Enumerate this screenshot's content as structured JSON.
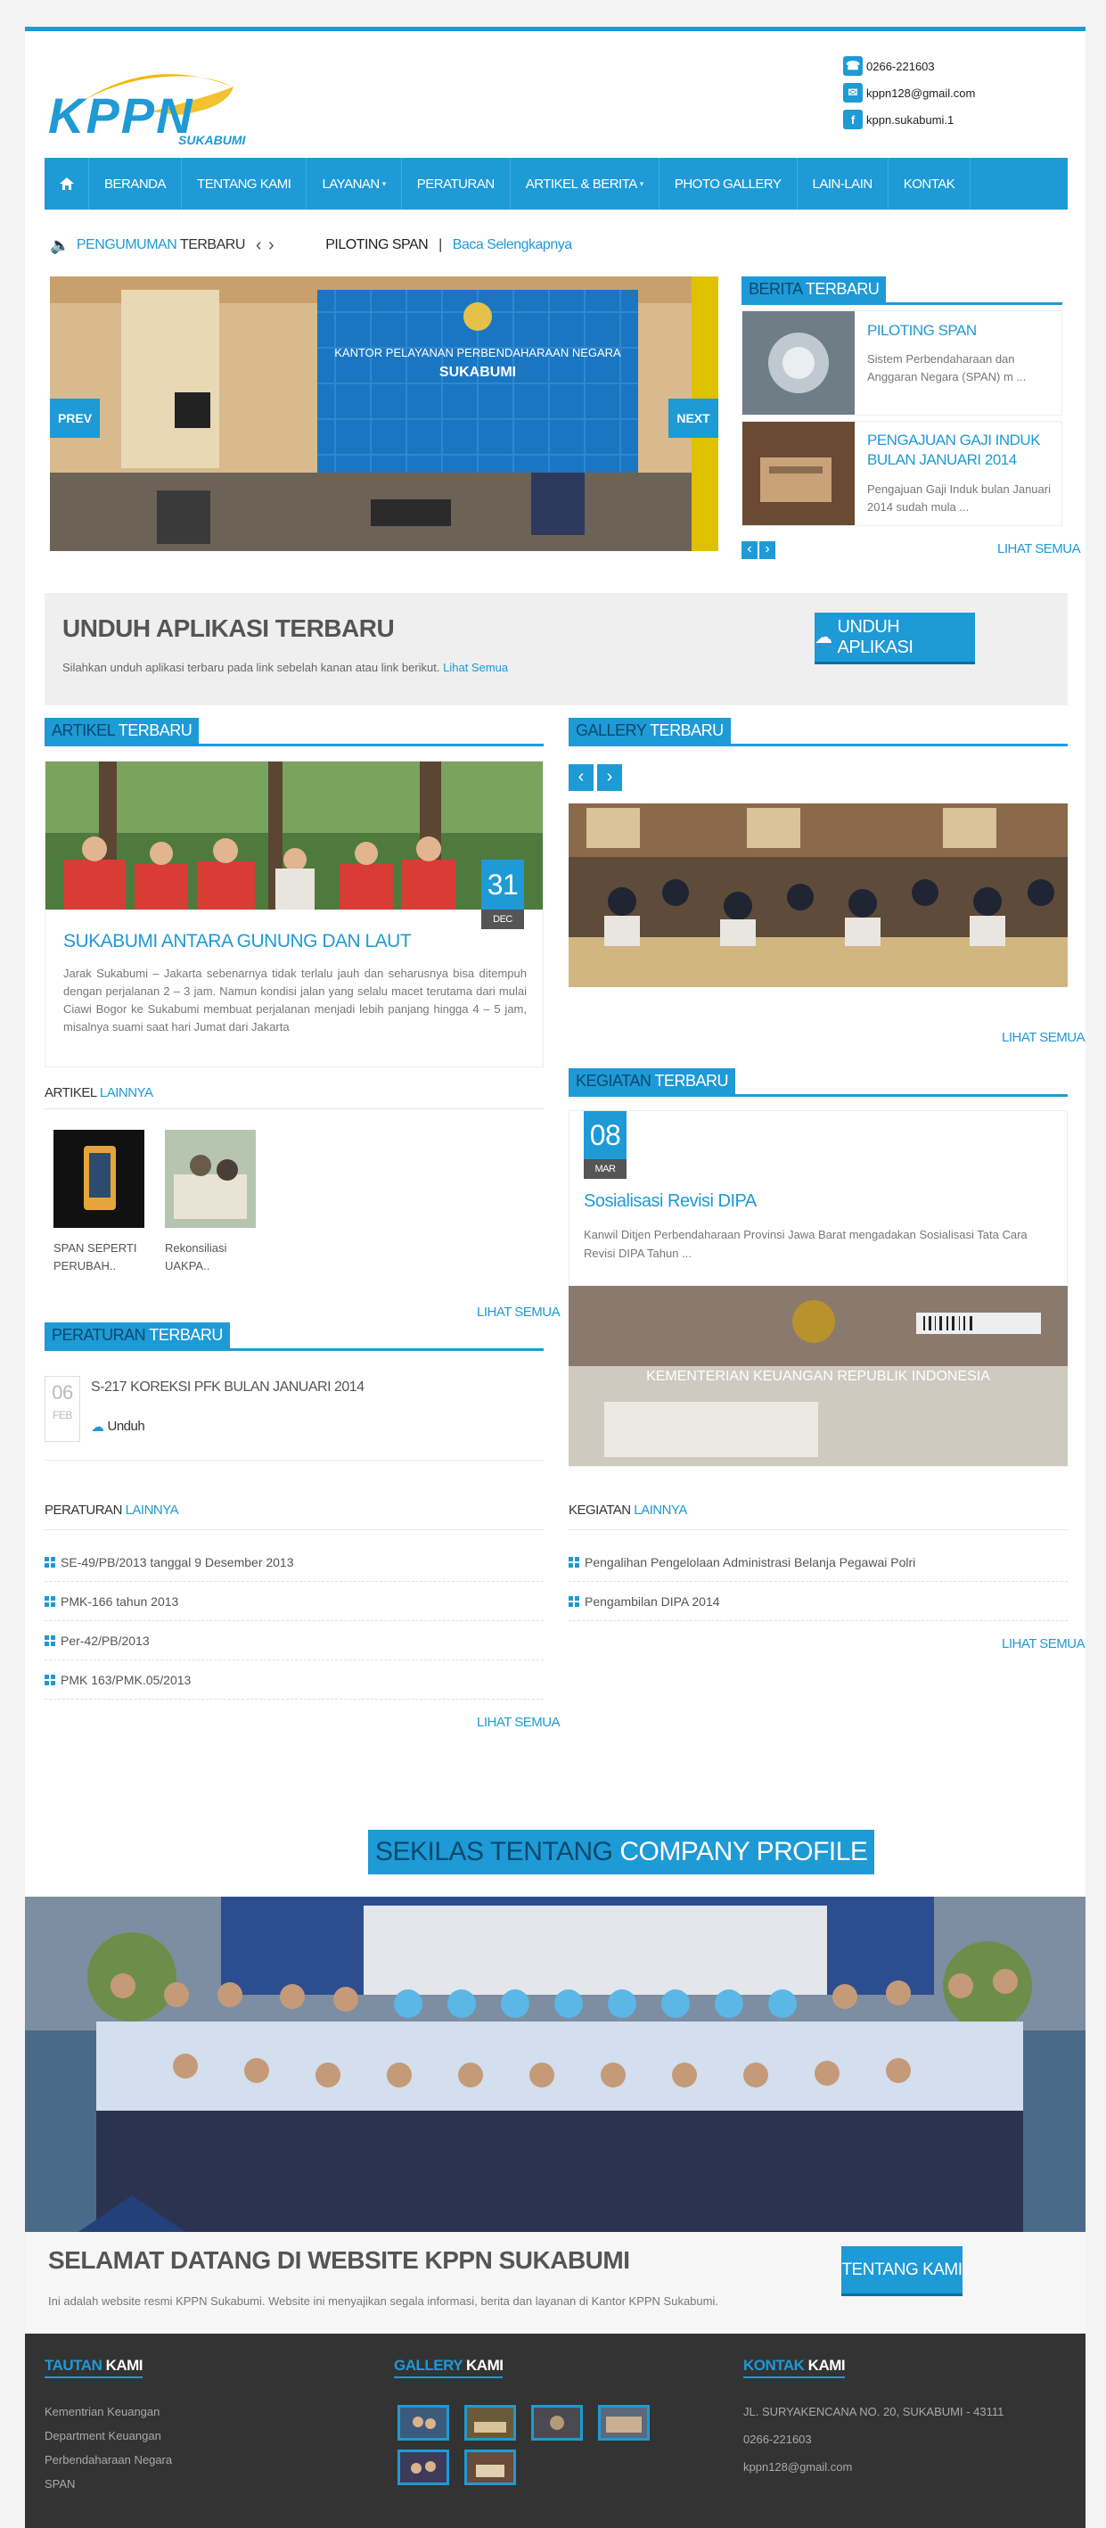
{
  "header": {
    "logo_text": "KPPN",
    "logo_sub": "SUKABUMI",
    "phone": "0266-221603",
    "email": "kppn128@gmail.com",
    "facebook": "kppn.sukabumi.1"
  },
  "nav": {
    "items": [
      "BERANDA",
      "TENTANG KAMI",
      "LAYANAN",
      "PERATURAN",
      "ARTIKEL & BERITA",
      "PHOTO GALLERY",
      "LAIN-LAIN",
      "KONTAK"
    ]
  },
  "ticker": {
    "label_a": "PENGUMUMAN",
    "label_b": " TERBARU",
    "headline": "PILOTING SPAN",
    "sep": " | ",
    "link": "Baca Selengkapnya"
  },
  "slider": {
    "prev": "PREV",
    "next": "NEXT",
    "sign1": "KANTOR PELAYANAN PERBENDAHARAAN NEGARA",
    "sign2": "SUKABUMI"
  },
  "berita": {
    "head_a": "BERITA",
    "head_b": " TERBARU",
    "items": [
      {
        "title": "PILOTING SPAN",
        "desc": "Sistem Perbendaharaan dan Anggaran Negara (SPAN) m ..."
      },
      {
        "title": "PENGAJUAN GAJI INDUK BULAN JANUARI 2014",
        "desc": "Pengajuan Gaji Induk bulan Januari 2014 sudah mula ..."
      }
    ],
    "more": "LIHAT SEMUA"
  },
  "unduh": {
    "title": "UNDUH APLIKASI TERBARU",
    "desc": "Silahkan unduh aplikasi terbaru pada link sebelah kanan atau link berikut. ",
    "link": "Lihat Semua",
    "button": "UNDUH APLIKASI"
  },
  "artikel": {
    "head_a": "ARTIKEL",
    "head_b": " TERBARU",
    "day": "31",
    "month": "DEC",
    "title": "SUKABUMI ANTARA GUNUNG DAN LAUT",
    "body": "Jarak Sukabumi – Jakarta sebenarnya tidak terlalu jauh dan seharusnya bisa ditempuh dengan perjalanan 2 – 3 jam. Namun kondisi jalan yang selalu macet terutama dari mulai Ciawi Bogor ke Sukabumi membuat perjalanan menjadi lebih panjang hingga 4 – 5 jam, misalnya suami saat hari Jumat dari Jakarta",
    "lain_a": "ARTIKEL",
    "lain_b": " LAINNYA",
    "others": [
      "SPAN SEPERTI PERUBAH..",
      "Rekonsiliasi UAKPA.."
    ],
    "more": "LIHAT SEMUA"
  },
  "gallery": {
    "head_a": "GALLERY",
    "head_b": " TERBARU",
    "more": "LIHAT SEMUA"
  },
  "kegiatan": {
    "head_a": "KEGIATAN",
    "head_b": " TERBARU",
    "day": "08",
    "month": "MAR",
    "title": "Sosialisasi Revisi DIPA",
    "body": "Kanwil Ditjen Perbendaharaan Provinsi Jawa Barat mengadakan Sosialisasi Tata Cara Revisi DIPA Tahun ...",
    "banner": "KEMENTERIAN KEUANGAN REPUBLIK INDONESIA",
    "lain_a": "KEGIATAN",
    "lain_b": " LAINNYA",
    "others": [
      "Pengalihan Pengelolaan Administrasi Belanja Pegawai Polri",
      "Pengambilan DIPA 2014"
    ],
    "more": "LIHAT SEMUA"
  },
  "peraturan": {
    "head_a": "PERATURAN",
    "head_b": " TERBARU",
    "day": "06",
    "month": "FEB",
    "title": "S-217 KOREKSI PFK BULAN JANUARI 2014",
    "download": "Unduh",
    "lain_a": "PERATURAN",
    "lain_b": " LAINNYA",
    "others": [
      "SE-49/PB/2013 tanggal 9 Desember 2013",
      "PMK-166 tahun 2013",
      "Per-42/PB/2013",
      "PMK 163/PMK.05/2013"
    ],
    "more": "LIHAT SEMUA"
  },
  "profile": {
    "head_a": "SEKILAS TENTANG",
    "head_b": " COMPANY PROFILE",
    "title": "SELAMAT DATANG DI WEBSITE KPPN SUKABUMI",
    "desc": "Ini adalah website resmi KPPN Sukabumi. Website ini menyajikan segala informasi, berita dan layanan di Kantor KPPN Sukabumi.",
    "button": "TENTANG KAMI"
  },
  "footer": {
    "tautan_a": "TAUTAN",
    "tautan_b": " KAMI",
    "links": [
      "Kementrian Keuangan",
      "Department Keuangan",
      "Perbendaharaan Negara",
      "SPAN"
    ],
    "gallery_a": "GALLERY",
    "gallery_b": " KAMI",
    "kontak_a": "KONTAK",
    "kontak_b": " KAMI",
    "address": "JL. SURYAKENCANA NO. 20, SUKABUMI - 43111",
    "phone": "0266-221603",
    "email": "kppn128@gmail.com"
  },
  "colors": {
    "accent": "#1e9ad6",
    "dark": "#333333"
  }
}
